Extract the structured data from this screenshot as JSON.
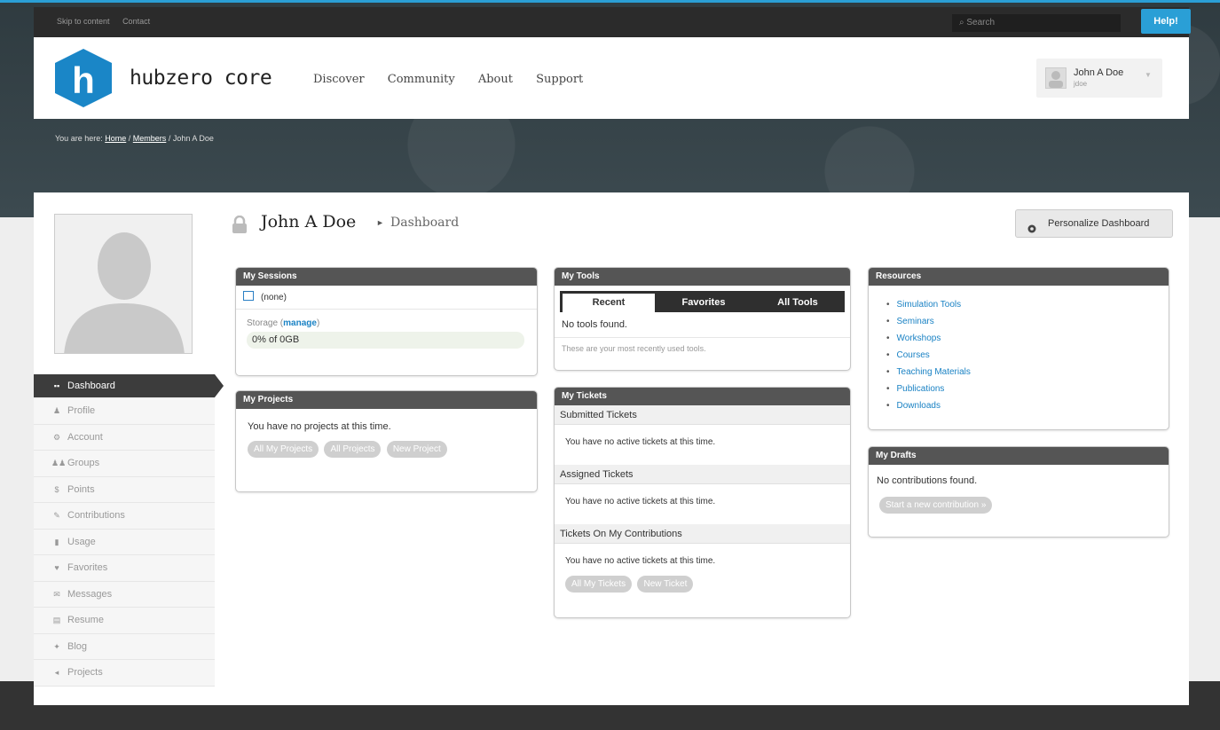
{
  "utility": {
    "skip_label": "Skip to content",
    "contact_label": "Contact",
    "search_placeholder": "Search",
    "help_label": "Help!"
  },
  "brand": {
    "name": "hubzero core",
    "mark": "h"
  },
  "nav": [
    {
      "label": "Discover"
    },
    {
      "label": "Community"
    },
    {
      "label": "About"
    },
    {
      "label": "Support"
    }
  ],
  "user": {
    "name": "John A Doe",
    "username": "jdoe"
  },
  "breadcrumb": {
    "prefix": "You are here:",
    "home": "Home",
    "sep": "/",
    "members": "Members",
    "current": "John A Doe"
  },
  "page": {
    "name": "John A Doe",
    "section": "Dashboard",
    "personalize_label": "Personalize Dashboard"
  },
  "sidebar": {
    "items": [
      {
        "label": "Dashboard",
        "icon": "dashboard-icon",
        "glyph": "▪▪",
        "active": true
      },
      {
        "label": "Profile",
        "icon": "profile-icon",
        "glyph": "♟"
      },
      {
        "label": "Account",
        "icon": "account-icon",
        "glyph": "⚙"
      },
      {
        "label": "Groups",
        "icon": "groups-icon",
        "glyph": "♟♟"
      },
      {
        "label": "Points",
        "icon": "points-icon",
        "glyph": "$"
      },
      {
        "label": "Contributions",
        "icon": "contributions-icon",
        "glyph": "✎"
      },
      {
        "label": "Usage",
        "icon": "usage-icon",
        "glyph": "▮"
      },
      {
        "label": "Favorites",
        "icon": "favorites-icon",
        "glyph": "♥"
      },
      {
        "label": "Messages",
        "icon": "messages-icon",
        "glyph": "✉"
      },
      {
        "label": "Resume",
        "icon": "resume-icon",
        "glyph": "▤"
      },
      {
        "label": "Blog",
        "icon": "blog-icon",
        "glyph": "✦"
      },
      {
        "label": "Projects",
        "icon": "projects-icon",
        "glyph": "◂"
      }
    ]
  },
  "sessions": {
    "title": "My Sessions",
    "none": "(none)",
    "storage_label": "Storage",
    "manage_label": "manage",
    "usage": "0% of 0GB"
  },
  "projects": {
    "title": "My Projects",
    "empty": "You have no projects at this time.",
    "buttons": [
      "All My Projects",
      "All Projects",
      "New Project"
    ]
  },
  "tools": {
    "title": "My Tools",
    "tabs": [
      "Recent",
      "Favorites",
      "All Tools"
    ],
    "empty": "No tools found.",
    "note": "These are your most recently used tools."
  },
  "tickets": {
    "title": "My Tickets",
    "sections": [
      {
        "heading": "Submitted Tickets",
        "text": "You have no active tickets at this time."
      },
      {
        "heading": "Assigned Tickets",
        "text": "You have no active tickets at this time."
      },
      {
        "heading": "Tickets On My Contributions",
        "text": "You have no active tickets at this time."
      }
    ],
    "buttons": [
      "All My Tickets",
      "New Ticket"
    ]
  },
  "resources": {
    "title": "Resources",
    "links": [
      "Simulation Tools",
      "Seminars",
      "Workshops",
      "Courses",
      "Teaching Materials",
      "Publications",
      "Downloads"
    ]
  },
  "drafts": {
    "title": "My Drafts",
    "empty": "No contributions found.",
    "button": "Start a new contribution »"
  },
  "colors": {
    "accent": "#2a9fd6",
    "link": "#1a82c4",
    "panel_header": "#555555"
  }
}
